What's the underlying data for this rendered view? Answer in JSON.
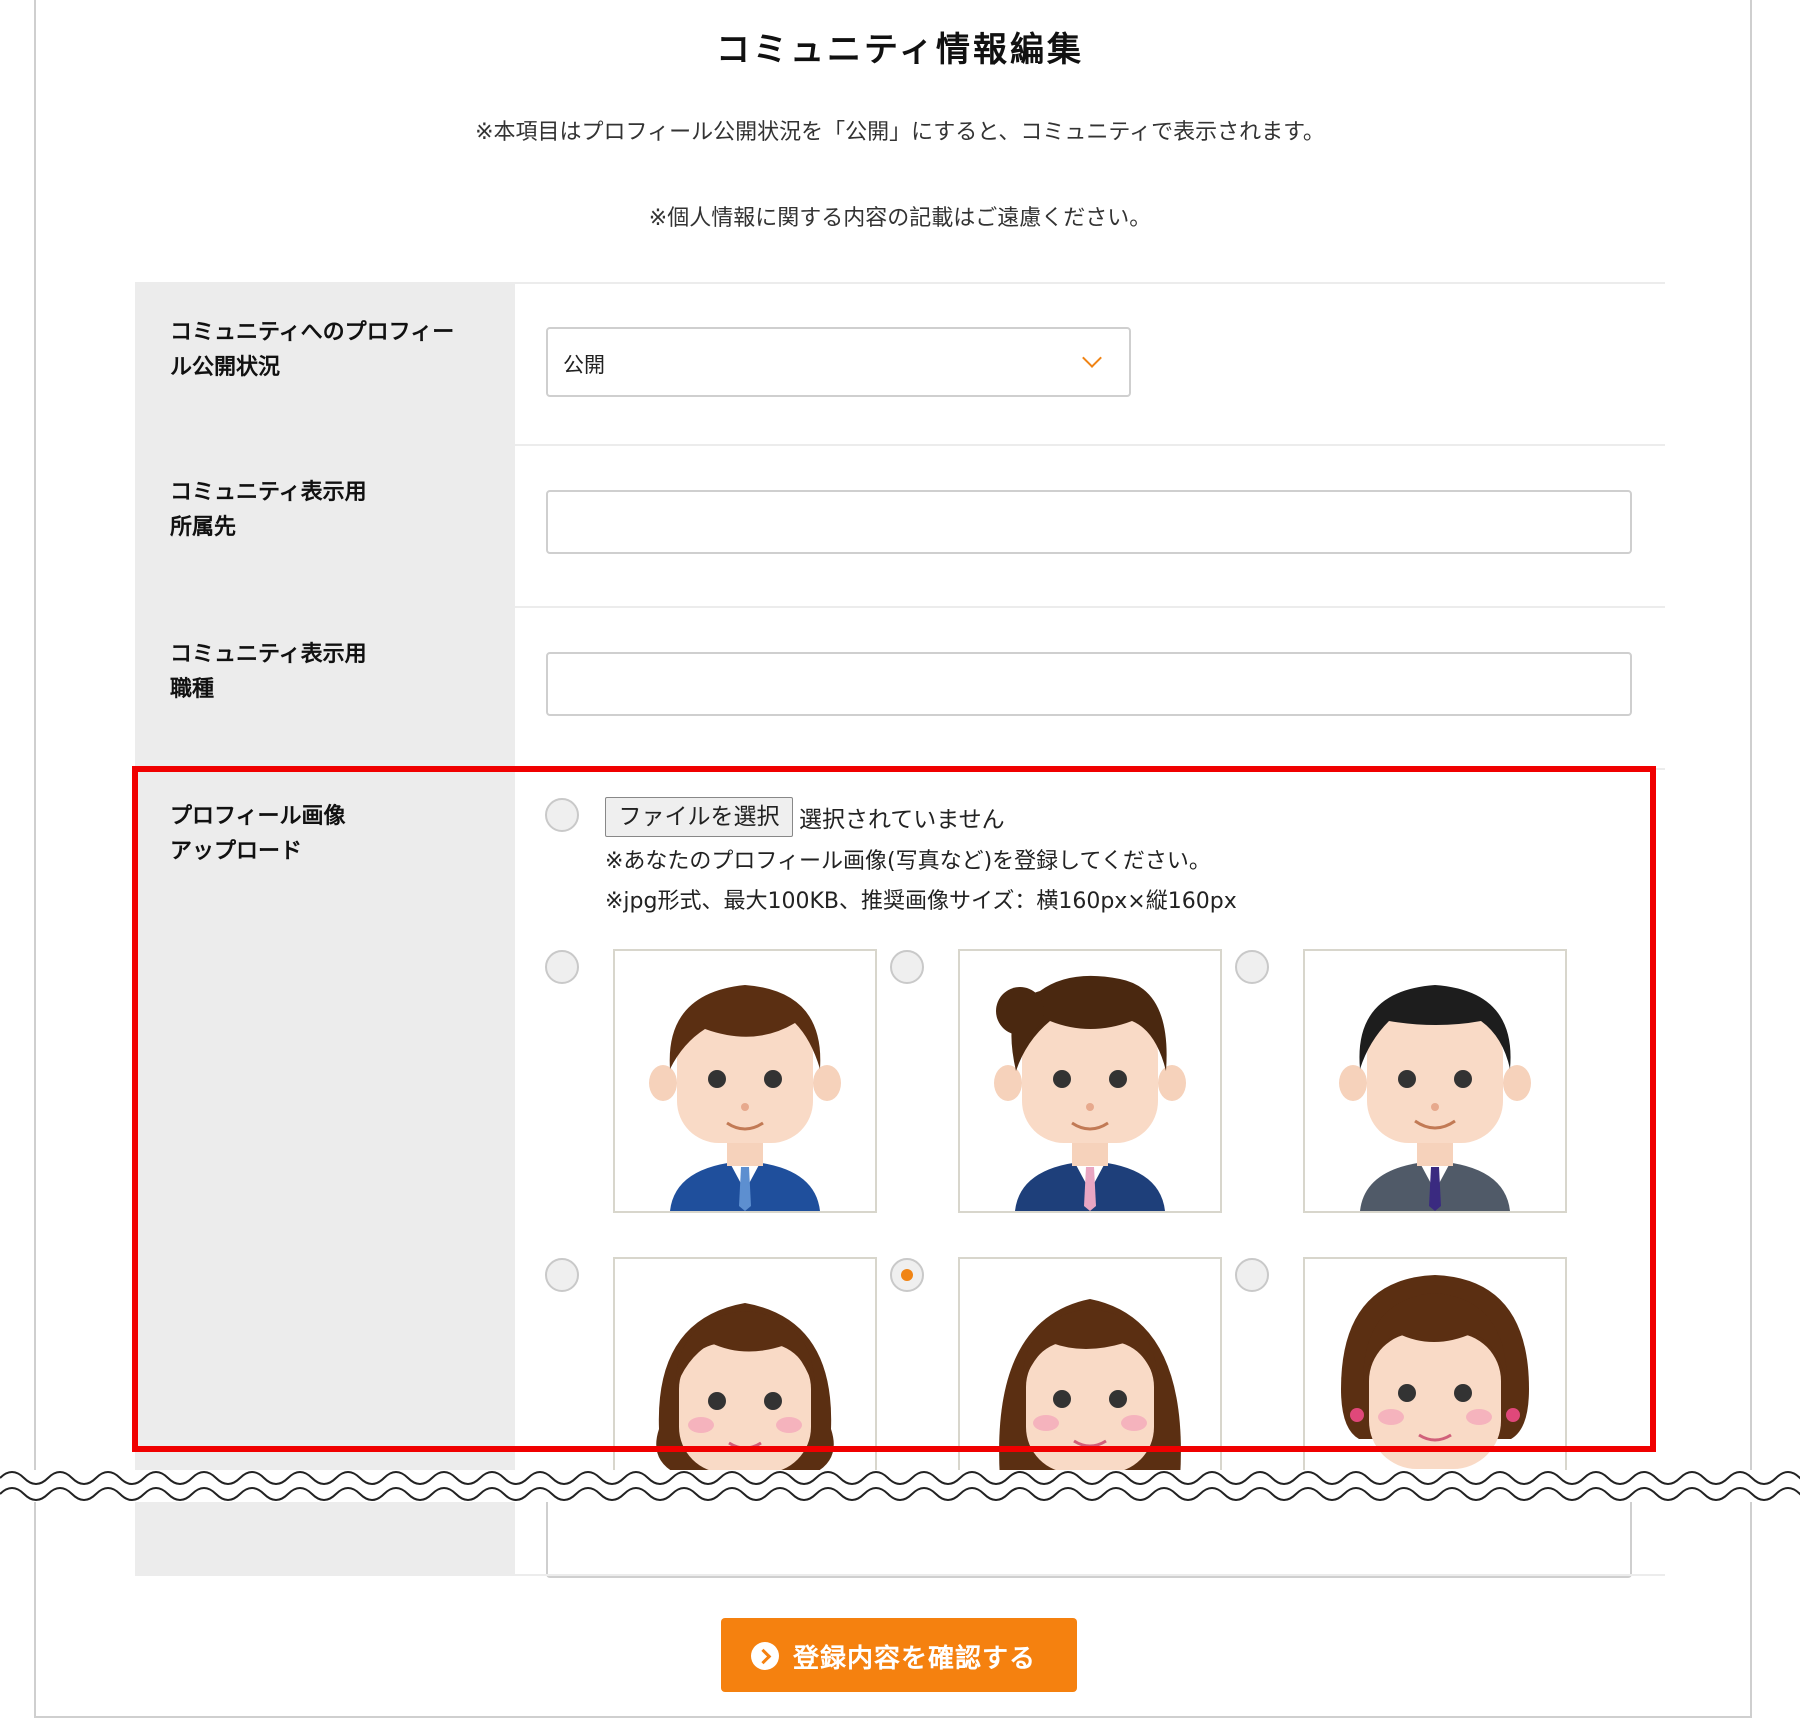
{
  "page": {
    "title": "コミュニティ情報編集",
    "note1": "※本項目はプロフィール公開状況を「公開」にすると、コミュニティで表示されます。",
    "note2": "※個人情報に関する内容の記載はご遠慮ください。"
  },
  "form": {
    "visibility": {
      "label_line1": "コミュニティへのプロフィー",
      "label_line2": "ル公開状況",
      "value": "公開"
    },
    "affiliation": {
      "label_line1": "コミュニティ表示用",
      "label_line2": "所属先",
      "value": ""
    },
    "occupation": {
      "label_line1": "コミュニティ表示用",
      "label_line2": "職種",
      "value": ""
    },
    "profile_image": {
      "label_line1": "プロフィール画像",
      "label_line2": "アップロード",
      "file_button": "ファイルを選択",
      "file_status": "選択されていません",
      "hint1": "※あなたのプロフィール画像(写真など)を登録してください。",
      "hint2": "※jpg形式、最大100KB、推奨画像サイズ：横160px×縦160px",
      "selected_avatar": "avatar-female-2",
      "avatars": [
        "avatar-male-1",
        "avatar-male-2",
        "avatar-male-3",
        "avatar-female-1",
        "avatar-female-2",
        "avatar-female-3"
      ]
    }
  },
  "submit_label": "登録内容を確認する",
  "colors": {
    "accent": "#f5810f",
    "highlight": "#f00000",
    "label_bg": "#ececec"
  }
}
